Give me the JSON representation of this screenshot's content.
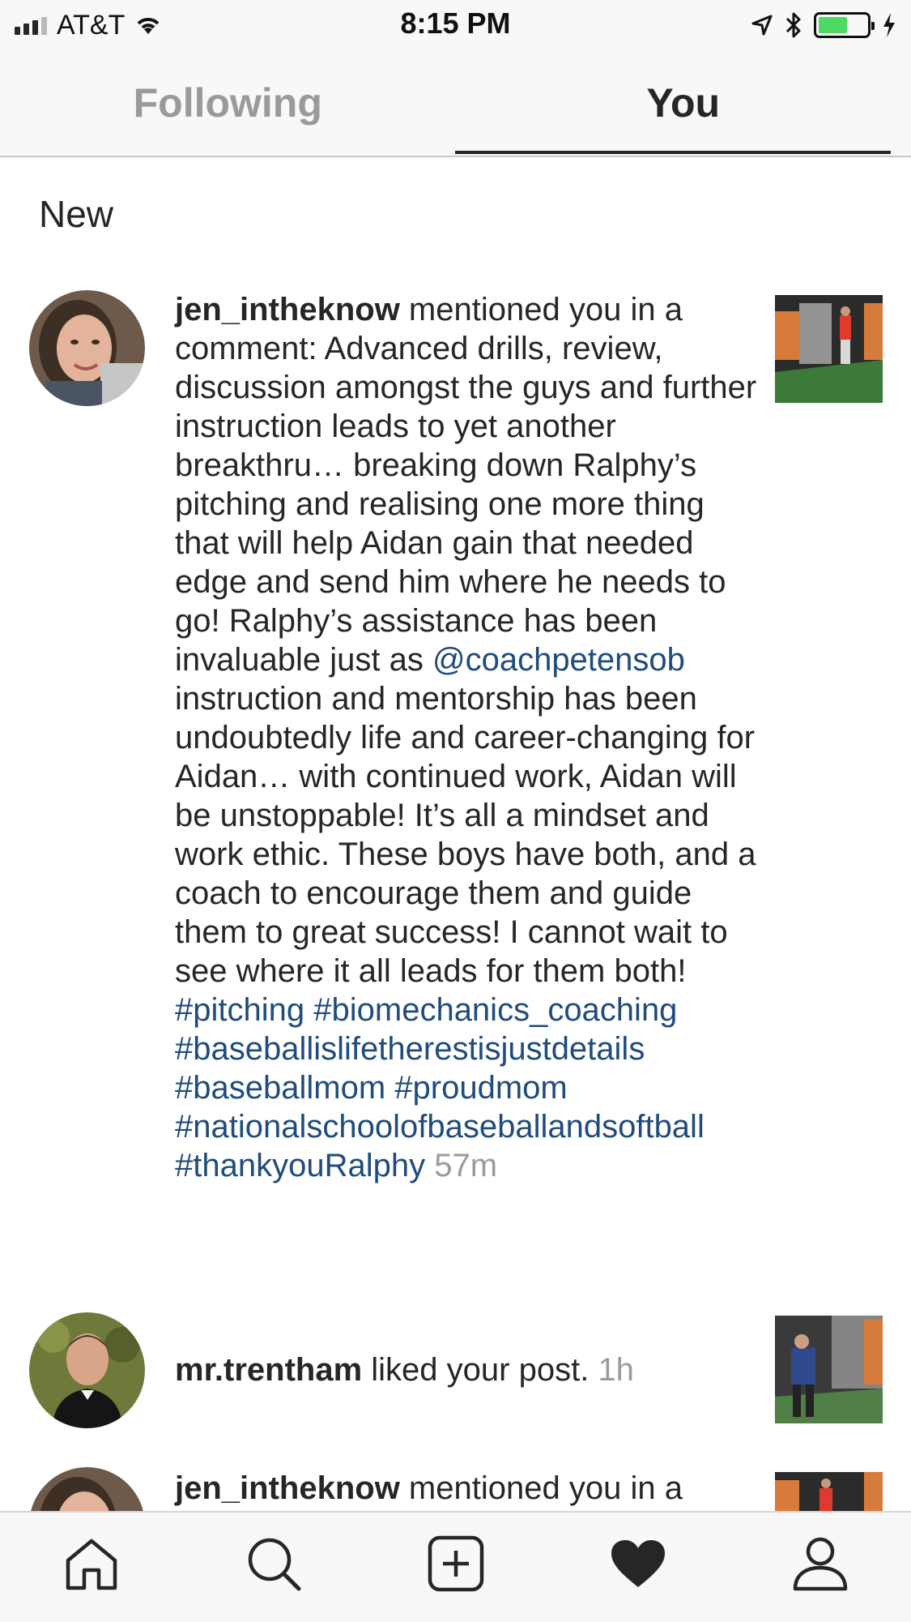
{
  "status_bar": {
    "carrier": "AT&T",
    "time": "8:15 PM",
    "battery_level": 0.6,
    "icons": [
      "signal-icon",
      "wifi-icon",
      "location-icon",
      "bluetooth-icon",
      "battery-icon",
      "charging-icon"
    ]
  },
  "tabs": {
    "following": "Following",
    "you": "You",
    "active": "You"
  },
  "section_title": "New",
  "notifications": [
    {
      "username": "jen_intheknow",
      "action": " mentioned you in a comment: Advanced drills, review, discussion amongst the guys and further instruction leads to yet another breakthru… breaking down Ralphy’s pitching and realising one more thing that will help Aidan gain that needed edge and send him where he needs to go!  Ralphy’s assistance has been invaluable just as ",
      "mention": "@coachpetensob",
      "text_after_mention": " instruction and mentorship has been undoubtedly life and career-changing for Aidan… with continued work, Aidan will be unstoppable!  It’s all a mindset and work ethic.  These boys have both, and a coach to encourage them and guide them to great success!  I cannot wait to see where it all leads for them both!  ",
      "hashtags": [
        "#pitching",
        "#biomechanics_coaching",
        "#baseballislifetherestisjustdetails",
        "#baseballmom",
        "#proudmom",
        "#nationalschoolofbaseballandsoftball",
        "#thankyouRalphy"
      ],
      "time": "57m"
    },
    {
      "username": "mr.trentham",
      "action": " liked your post.",
      "time": "1h"
    },
    {
      "username": "jen_intheknow",
      "action": " mentioned you in a"
    }
  ],
  "bottom_nav": [
    "home-icon",
    "search-icon",
    "add-post-icon",
    "activity-heart-icon",
    "profile-icon"
  ],
  "colors": {
    "link": "#1f4b7e",
    "muted": "#9a9a9a",
    "text": "#262626",
    "battery": "#4cd964"
  }
}
